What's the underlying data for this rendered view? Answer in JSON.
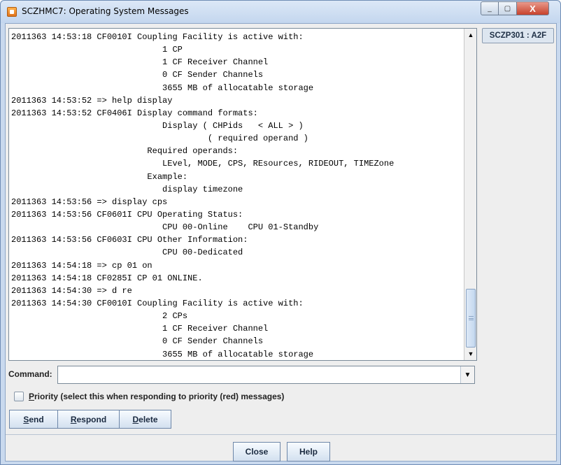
{
  "window": {
    "title": "SCZHMC7: Operating System Messages",
    "controls": {
      "minimize": "_",
      "maximize": "▢",
      "close": "X"
    }
  },
  "tab": {
    "label": "SCZP301 : A2F"
  },
  "messages": [
    "2011363 14:53:18 CF0010I Coupling Facility is active with:",
    "                              1 CP",
    "                              1 CF Receiver Channel",
    "                              0 CF Sender Channels",
    "                              3655 MB of allocatable storage",
    "2011363 14:53:52 => help display",
    "2011363 14:53:52 CF0406I Display command formats:",
    "                              Display ( CHPids   < ALL > )",
    "                                       ( required operand )",
    "                           Required operands:",
    "                              LEvel, MODE, CPS, REsources, RIDEOUT, TIMEZone",
    "                           Example:",
    "                              display timezone",
    "2011363 14:53:56 => display cps",
    "2011363 14:53:56 CF0601I CPU Operating Status:",
    "                              CPU 00-Online    CPU 01-Standby",
    "2011363 14:53:56 CF0603I CPU Other Information:",
    "                              CPU 00-Dedicated",
    "2011363 14:54:18 => cp 01 on",
    "2011363 14:54:18 CF0285I CP 01 ONLINE.",
    "2011363 14:54:30 => d re",
    "2011363 14:54:30 CF0010I Coupling Facility is active with:",
    "                              2 CPs",
    "                              1 CF Receiver Channel",
    "                              0 CF Sender Channels",
    "                              3655 MB of allocatable storage"
  ],
  "command": {
    "label": "Command:",
    "value": ""
  },
  "priority": {
    "label_underlined": "P",
    "label_rest": "riority (select this when responding to priority (red) messages)",
    "checked": false
  },
  "actions": {
    "send": {
      "ul": "S",
      "rest": "end"
    },
    "respond": {
      "ul": "R",
      "rest": "espond"
    },
    "delete": {
      "ul": "D",
      "rest": "elete"
    }
  },
  "footer": {
    "close_label": "Close",
    "help_label": "Help"
  },
  "icons": {
    "app": "java-app-icon",
    "scroll_up": "▲",
    "scroll_down": "▼",
    "combo_arrow": "▼"
  }
}
